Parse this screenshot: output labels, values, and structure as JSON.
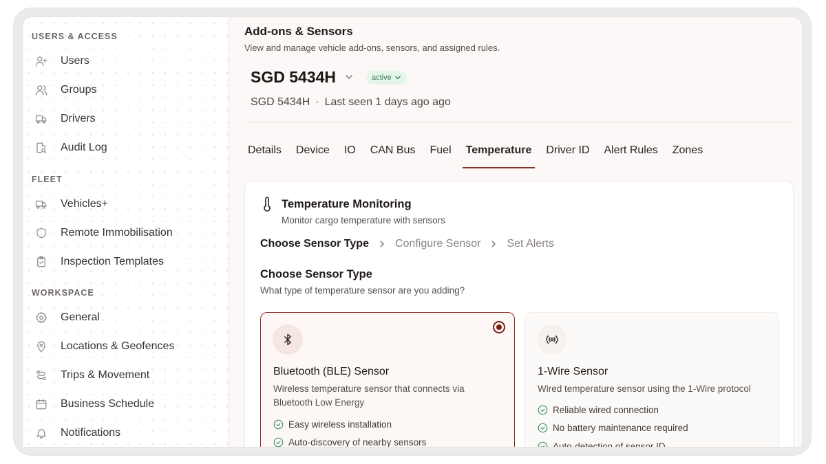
{
  "sidebar": {
    "sections": [
      {
        "label": "USERS & ACCESS",
        "items": [
          {
            "label": "Users",
            "icon": "user-plus-icon"
          },
          {
            "label": "Groups",
            "icon": "users-icon"
          },
          {
            "label": "Drivers",
            "icon": "truck-icon"
          },
          {
            "label": "Audit Log",
            "icon": "file-search-icon"
          }
        ]
      },
      {
        "label": "FLEET",
        "items": [
          {
            "label": "Vehicles+",
            "icon": "truck-icon"
          },
          {
            "label": "Remote Immobilisation",
            "icon": "shield-icon"
          },
          {
            "label": "Inspection Templates",
            "icon": "clipboard-check-icon"
          }
        ]
      },
      {
        "label": "WORKSPACE",
        "items": [
          {
            "label": "General",
            "icon": "gear-icon"
          },
          {
            "label": "Locations & Geofences",
            "icon": "map-pin-icon"
          },
          {
            "label": "Trips & Movement",
            "icon": "route-icon"
          },
          {
            "label": "Business Schedule",
            "icon": "calendar-icon"
          },
          {
            "label": "Notifications",
            "icon": "bell-icon"
          }
        ]
      }
    ]
  },
  "header": {
    "title": "Add-ons & Sensors",
    "subtitle": "View and manage vehicle add-ons, sensors, and assigned rules."
  },
  "vehicle": {
    "name": "SGD 5434H",
    "status": "active",
    "plate": "SGD 5434H",
    "separator": "·",
    "last_seen": "Last seen 1 days ago ago"
  },
  "tabs": [
    {
      "label": "Details",
      "active": false
    },
    {
      "label": "Device",
      "active": false
    },
    {
      "label": "IO",
      "active": false
    },
    {
      "label": "CAN Bus",
      "active": false
    },
    {
      "label": "Fuel",
      "active": false
    },
    {
      "label": "Temperature",
      "active": true
    },
    {
      "label": "Driver ID",
      "active": false
    },
    {
      "label": "Alert Rules",
      "active": false
    },
    {
      "label": "Zones",
      "active": false
    }
  ],
  "panel": {
    "title": "Temperature Monitoring",
    "subtitle": "Monitor cargo temperature with sensors",
    "steps": [
      "Choose Sensor Type",
      "Configure Sensor",
      "Set Alerts"
    ],
    "active_step": 0,
    "section_title": "Choose Sensor Type",
    "section_subtitle": "What type of temperature sensor are you adding?",
    "options": [
      {
        "icon": "bluetooth-icon",
        "title": "Bluetooth (BLE) Sensor",
        "description": "Wireless temperature sensor that connects via Bluetooth Low Energy",
        "features": [
          "Easy wireless installation",
          "Auto-discovery of nearby sensors"
        ],
        "selected": true
      },
      {
        "icon": "broadcast-icon",
        "title": "1-Wire Sensor",
        "description": "Wired temperature sensor using the 1-Wire protocol",
        "features": [
          "Reliable wired connection",
          "No battery maintenance required",
          "Auto-detection of sensor ID"
        ],
        "selected": false
      }
    ]
  },
  "colors": {
    "accent": "#8b2f24",
    "status_bg": "#e6f5ea",
    "status_text": "#2e7d4a",
    "check": "#2e8b57"
  }
}
